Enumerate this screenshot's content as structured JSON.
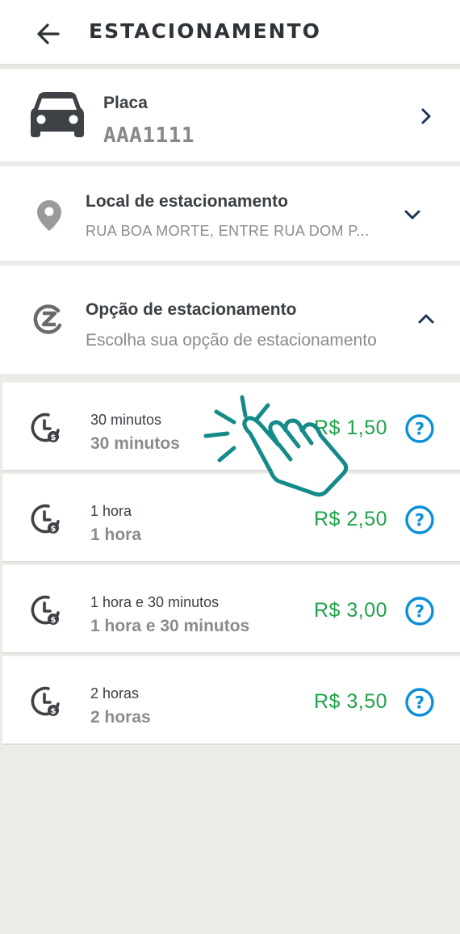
{
  "header": {
    "title": "ESTACIONAMENTO",
    "back_icon": "arrow-left-icon"
  },
  "placa": {
    "label": "Placa",
    "value": "AAA1111",
    "icon": "car-icon",
    "chevron": "chevron-right-icon"
  },
  "local": {
    "label": "Local de estacionamento",
    "value": "RUA BOA MORTE, ENTRE RUA DOM P...",
    "icon": "location-pin-icon",
    "chevron": "chevron-down-icon"
  },
  "opcao": {
    "label": "Opção de estacionamento",
    "subtitle": "Escolha sua opção de estacionamento",
    "icon": "zona-azul-icon",
    "chevron": "chevron-up-icon"
  },
  "options": [
    {
      "title": "30 minutos",
      "subtitle": "30 minutos",
      "price": "R$ 1,50"
    },
    {
      "title": "1 hora",
      "subtitle": "1 hora",
      "price": "R$ 2,50"
    },
    {
      "title": "1 hora e 30 minutos",
      "subtitle": "1 hora e 30 minutos",
      "price": "R$ 3,00"
    },
    {
      "title": "2 horas",
      "subtitle": "2 horas",
      "price": "R$ 3,50"
    }
  ],
  "colors": {
    "price": "#1fa24a",
    "help": "#0a8fd9",
    "hand_overlay": "#148a8a",
    "text_dark": "#3a3f44",
    "text_muted": "#8b8b8b",
    "background": "#ecece7"
  }
}
